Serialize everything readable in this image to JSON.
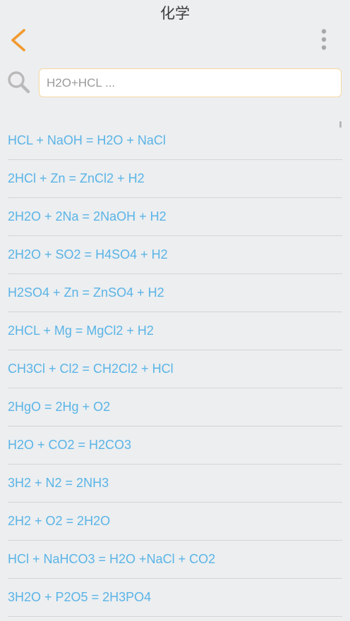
{
  "header": {
    "title": "化学",
    "accent_color": "#f29a2e"
  },
  "search": {
    "placeholder": "H2O+HCL ..."
  },
  "reactions": [
    "HCL + NaOH = H2O + NaCl",
    "2HCl + Zn = ZnCl2 + H2",
    "2H2O + 2Na = 2NaOH + H2",
    "2H2O + SO2 = H4SO4 + H2",
    "H2SO4 + Zn = ZnSO4 + H2",
    "2HCL + Mg = MgCl2 + H2",
    "CH3Cl + Cl2 = CH2Cl2 + HCl",
    "2HgO = 2Hg + O2",
    "H2O + CO2 = H2CO3",
    "3H2 + N2 = 2NH3",
    "2H2 + O2 = 2H2O",
    "HCl + NaHCO3 = H2O +NaCl + CO2",
    "3H2O + P2O5 = 2H3PO4"
  ],
  "colors": {
    "reaction_text": "#5ab4e6",
    "background": "#eceef0",
    "search_border": "#f5d7a1",
    "icon_gray": "#b9b9b9"
  }
}
